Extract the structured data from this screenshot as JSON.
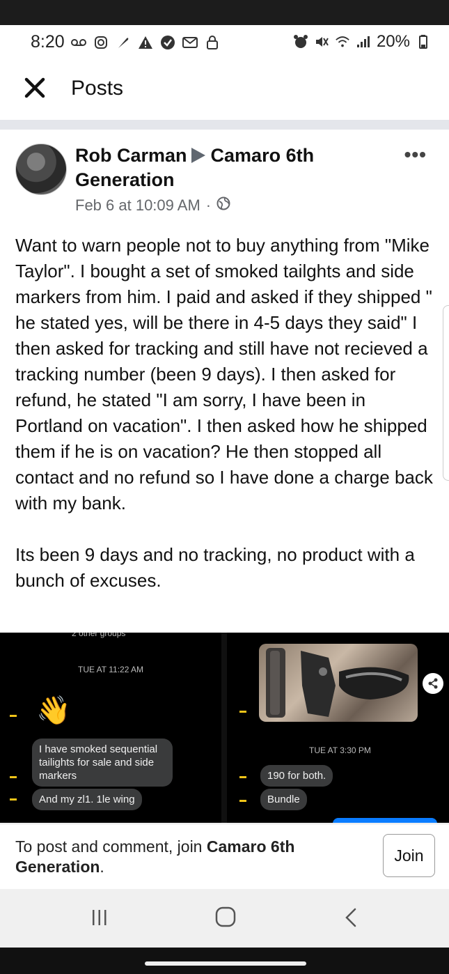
{
  "status_bar": {
    "time": "8:20",
    "battery": "20%"
  },
  "header": {
    "title": "Posts"
  },
  "post": {
    "author": "Rob Carman",
    "group": "Camaro 6th Generation",
    "timestamp": "Feb 6 at 10:09 AM",
    "separator": "·",
    "more_label": "•••",
    "paragraphs": [
      "Want to warn people not to buy anything from \"Mike Taylor\". I bought a set of smoked tailghts and side markers from him. I paid and asked if they shipped \" he stated yes, will be there in 4-5 days they said\" I then asked for tracking and still have not recieved a tracking number (been 9 days). I then asked for refund, he stated \"I am sorry, I have been in Portland on vacation\". I then asked how he shipped them if he is on vacation? He then stopped all contact and no refund so I have done a charge back with my bank.",
      "Its been 9 days and no tracking, no product with a bunch of excuses."
    ],
    "images": {
      "left": {
        "cut_text": "2 other groups",
        "time": "TUE AT 11:22 AM",
        "wave_emoji": "👋",
        "messages": [
          "I have smoked sequential tailights for sale and side markers",
          "And my zl1. 1le wing"
        ]
      },
      "right": {
        "time": "TUE AT 3:30 PM",
        "messages": [
          "190 for both.",
          "Bundle"
        ]
      }
    }
  },
  "join_bar": {
    "prefix": "To post and comment, join ",
    "group": "Camaro 6th Generation",
    "suffix": ".",
    "button": "Join"
  },
  "colors": {
    "facebook_blue": "#0a7cff",
    "muted_text": "#65676b",
    "separator_grey": "#e4e6eb",
    "bubble_grey": "#3a3b3c"
  }
}
